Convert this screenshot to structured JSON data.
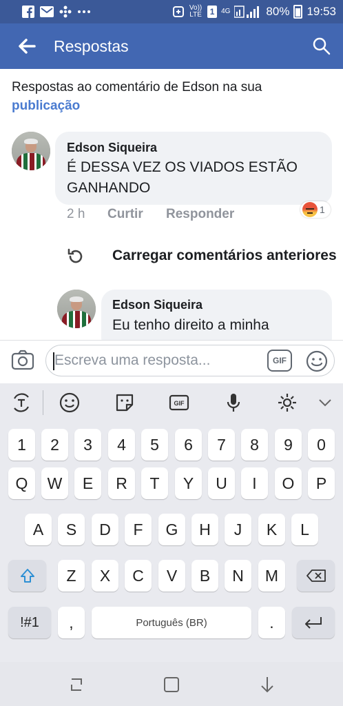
{
  "status_bar": {
    "icons": [
      "facebook-icon",
      "gmail-icon",
      "pinwheel-icon",
      "more-dots-icon",
      "data-saver-icon",
      "volte-icon",
      "sim-1-icon",
      "4g-icon",
      "signal-icon"
    ],
    "volte": "Vo)) LTE",
    "sim": "1",
    "network": "4G",
    "battery": "80%",
    "time": "19:53"
  },
  "header": {
    "title": "Respostas"
  },
  "intro": {
    "text": "Respostas ao comentário de Edson na sua",
    "link": "publicação"
  },
  "comment": {
    "author": "Edson Siqueira",
    "text": "É DESSA VEZ OS VIADOS ESTÃO GANHANDO",
    "time": "2 h",
    "like": "Curtir",
    "reply": "Responder",
    "reaction_count": "1",
    "reaction_icon": "angry-reaction-icon"
  },
  "load_previous": {
    "label": "Carregar comentários anteriores"
  },
  "reply": {
    "author": "Edson Siqueira",
    "text": "Eu tenho direito a minha"
  },
  "reply_bar": {
    "placeholder": "Escreva uma resposta...",
    "gif": "GIF"
  },
  "keyboard": {
    "toolbar": [
      "translate-icon",
      "emoji-icon",
      "sticker-icon",
      "gif-icon",
      "microphone-icon",
      "settings-icon",
      "chevron-down-icon"
    ],
    "row_numbers": [
      "1",
      "2",
      "3",
      "4",
      "5",
      "6",
      "7",
      "8",
      "9",
      "0"
    ],
    "row_1": [
      "Q",
      "W",
      "E",
      "R",
      "T",
      "Y",
      "U",
      "I",
      "O",
      "P"
    ],
    "row_2": [
      "A",
      "S",
      "D",
      "F",
      "G",
      "H",
      "J",
      "K",
      "L"
    ],
    "row_3": [
      "Z",
      "X",
      "C",
      "V",
      "B",
      "N",
      "M"
    ],
    "symbols": "!#1",
    "comma": ",",
    "space": "Português (BR)",
    "period": "."
  },
  "nav_bar": {
    "buttons": [
      "recent-apps-icon",
      "home-icon",
      "back-icon"
    ]
  },
  "colors": {
    "status_bar": "#3b5998",
    "header": "#4267b2",
    "link": "#4a7bd0",
    "bubble": "#f0f2f5",
    "keyboard": "#e9eaef"
  }
}
